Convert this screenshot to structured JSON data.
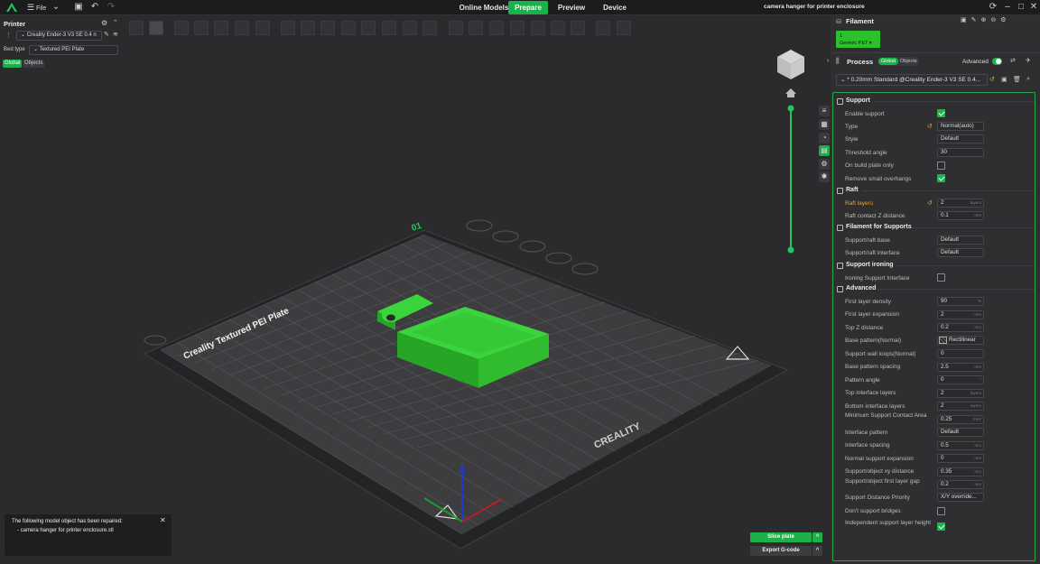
{
  "topbar": {
    "file_label": "File",
    "tabs": [
      "Online Models",
      "Prepare",
      "Preview",
      "Device"
    ],
    "active_tab": "Prepare",
    "window_title": "camera hanger for printer enclosure"
  },
  "printer_panel": {
    "title": "Printer",
    "printer_name": "Creality Ender-3 V3 SE 0.4 n",
    "bed_type_label": "Bed type",
    "bed_type_value": "Textured PEI Plate",
    "tab_global": "Global",
    "tab_objects": "Objects"
  },
  "plate": {
    "label": "Creality Textured PEI Plate",
    "plate_number": "01",
    "brand": "CREALITY"
  },
  "notification": {
    "line1": "The following model object has been repaired:",
    "line2": "- camera hanger for printer enclosure.stl"
  },
  "bottom_buttons": {
    "slice": "Slice plate",
    "export": "Export G-code"
  },
  "filament": {
    "title": "Filament",
    "slot": "1",
    "name": "Generic PET"
  },
  "process": {
    "title": "Process",
    "tab_global": "Global",
    "tab_objects": "Objects",
    "advanced_label": "Advanced",
    "preset": "* 0.20mm Standard @Creality Ender-3 V3 SE 0.4..."
  },
  "sections": {
    "support": "Support",
    "raft": "Raft",
    "filament_for_supports": "Filament for Supports",
    "support_ironing": "Support ironing",
    "advanced": "Advanced"
  },
  "params": {
    "enable_support": {
      "label": "Enable support",
      "checked": true
    },
    "type": {
      "label": "Type",
      "value": "Normal(auto)"
    },
    "style": {
      "label": "Style",
      "value": "Default"
    },
    "threshold_angle": {
      "label": "Threshold angle",
      "value": "30"
    },
    "on_build_plate_only": {
      "label": "On build plate only",
      "checked": false
    },
    "remove_small_overhangs": {
      "label": "Remove small overhangs",
      "checked": true
    },
    "raft_layers": {
      "label": "Raft layers",
      "value": "2",
      "unit": "layers"
    },
    "raft_contact_z": {
      "label": "Raft contact Z distance",
      "value": "0.1",
      "unit": "mm"
    },
    "support_raft_base": {
      "label": "Support/raft base",
      "value": "Default"
    },
    "support_raft_interface": {
      "label": "Support/raft interface",
      "value": "Default"
    },
    "ironing_support_interface": {
      "label": "Ironing Support Interface",
      "checked": false
    },
    "first_layer_density": {
      "label": "First layer density",
      "value": "90",
      "unit": "%"
    },
    "first_layer_expansion": {
      "label": "First layer expansion",
      "value": "2",
      "unit": "mm"
    },
    "top_z_distance": {
      "label": "Top Z distance",
      "value": "0.2",
      "unit": "mm"
    },
    "base_pattern": {
      "label": "Base pattern(Normal)",
      "value": "Rectilinear"
    },
    "support_wall_loops": {
      "label": "Support wall loops(Normal)",
      "value": "0"
    },
    "base_pattern_spacing": {
      "label": "Base pattern spacing",
      "value": "2.5",
      "unit": "mm"
    },
    "pattern_angle": {
      "label": "Pattern angle",
      "value": "0",
      "unit": "°"
    },
    "top_interface_layers": {
      "label": "Top interface layers",
      "value": "2",
      "unit": "layers"
    },
    "bottom_interface_layers": {
      "label": "Bottom interface layers",
      "value": "2",
      "unit": "layers"
    },
    "min_support_contact_area": {
      "label": "Minimum Support Contact Area",
      "value": "0.25",
      "unit": "mm²"
    },
    "interface_pattern": {
      "label": "Interface pattern",
      "value": "Default"
    },
    "interface_spacing": {
      "label": "Interface spacing",
      "value": "0.5",
      "unit": "mm"
    },
    "normal_support_expansion": {
      "label": "Normal support expansion",
      "value": "0",
      "unit": "mm"
    },
    "support_object_xy": {
      "label": "Support/object xy distance",
      "value": "0.35",
      "unit": "mm"
    },
    "support_object_first_layer_gap": {
      "label": "Support/object first layer gap",
      "value": "0.2",
      "unit": "mm"
    },
    "support_distance_priority": {
      "label": "Support Distance Priority",
      "value": "X/Y override..."
    },
    "dont_support_bridges": {
      "label": "Don't support bridges",
      "checked": false
    },
    "independent_support_layer": {
      "label": "Independent support layer height",
      "checked": true
    }
  },
  "colors": {
    "accent": "#17b348",
    "model": "#2fcc2f",
    "bed": "#3a3a3d",
    "background": "#2b2b2e",
    "warning": "#e9a13a"
  }
}
